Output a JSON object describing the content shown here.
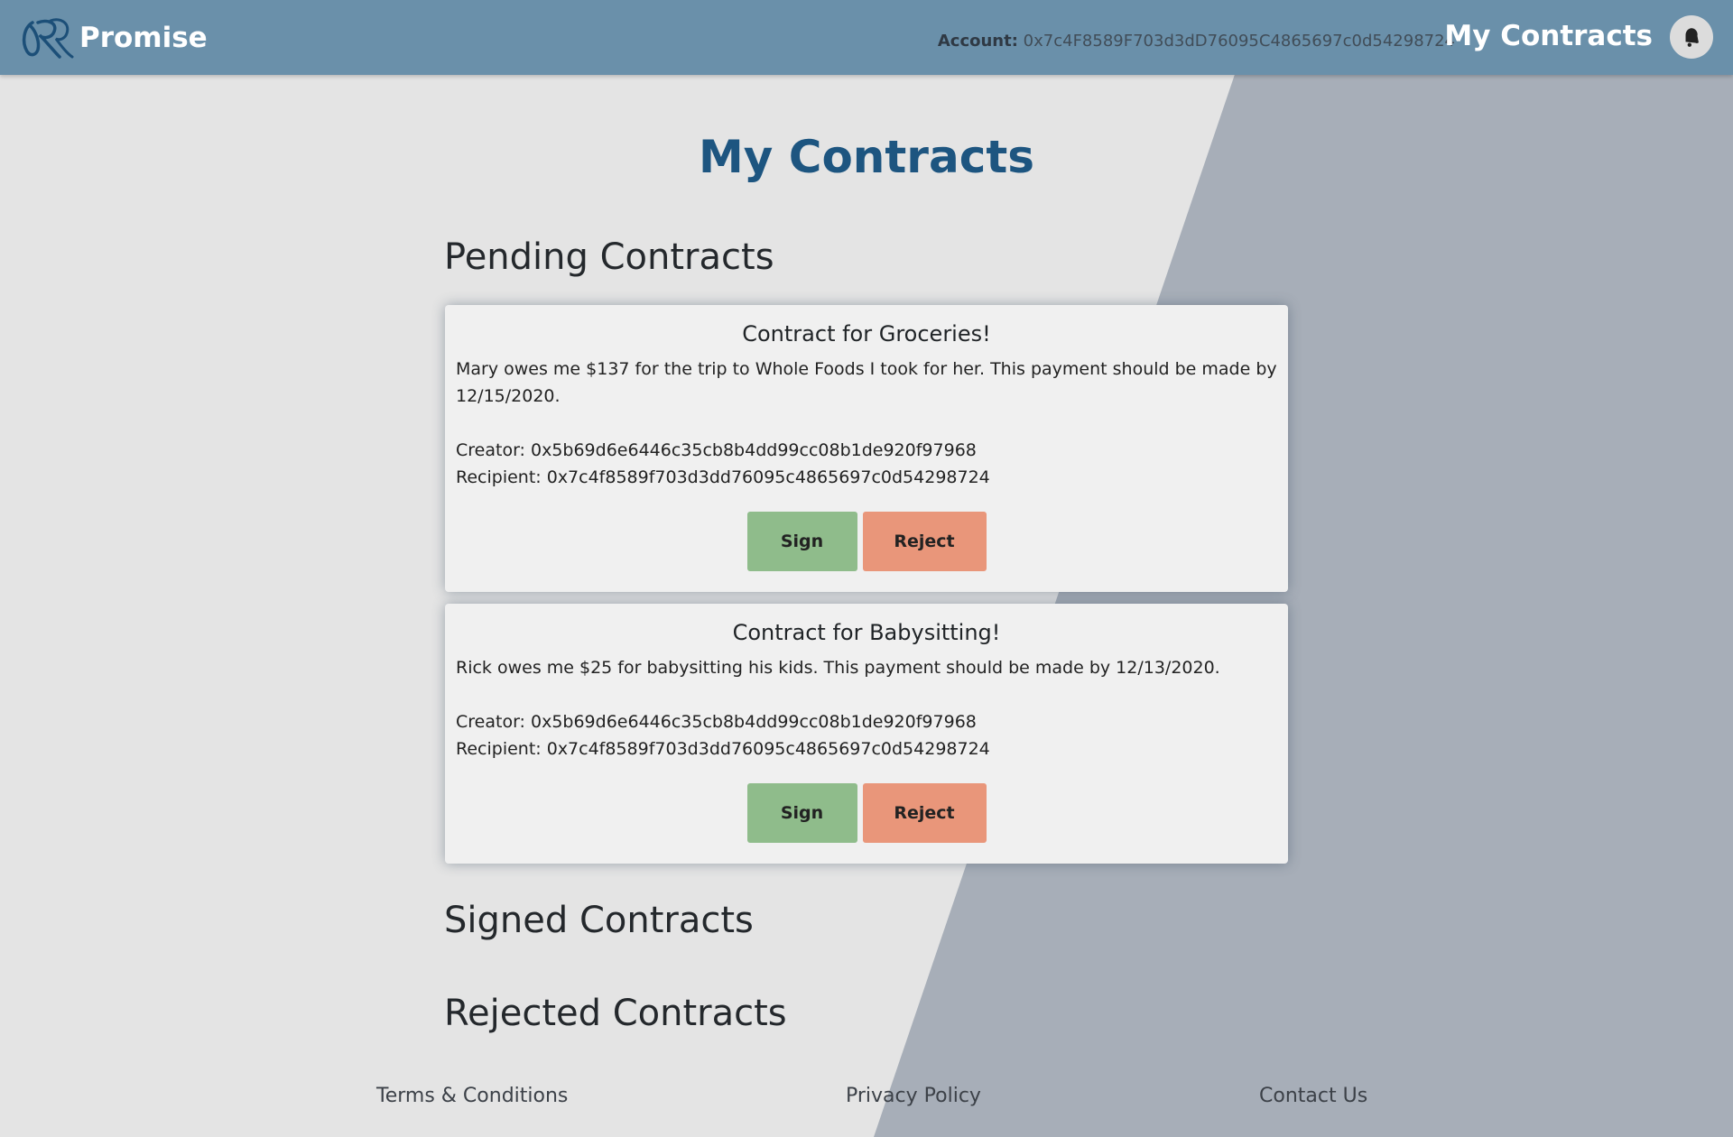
{
  "navbar": {
    "brand_name": "Promise",
    "account_label": "Account:",
    "account_value": "0x7c4F8589F703d3dD76095C4865697c0d54298724",
    "nav_title": "My Contracts"
  },
  "page_title": "My Contracts",
  "sections": {
    "pending": "Pending Contracts",
    "signed": "Signed Contracts",
    "rejected": "Rejected Contracts"
  },
  "pending_contracts": [
    {
      "title": "Contract for Groceries!",
      "description": "Mary owes me $137 for the trip to Whole Foods I took for her. This payment should be made by 12/15/2020.",
      "creator": "Creator: 0x5b69d6e6446c35cb8b4dd99cc08b1de920f97968",
      "recipient": "Recipient: 0x7c4f8589f703d3dd76095c4865697c0d54298724",
      "sign_label": "Sign",
      "reject_label": "Reject"
    },
    {
      "title": "Contract for Babysitting!",
      "description": "Rick owes me $25 for babysitting his kids. This payment should be made by 12/13/2020.",
      "creator": "Creator: 0x5b69d6e6446c35cb8b4dd99cc08b1de920f97968",
      "recipient": "Recipient: 0x7c4f8589f703d3dd76095c4865697c0d54298724",
      "sign_label": "Sign",
      "reject_label": "Reject"
    }
  ],
  "footer": {
    "terms": "Terms & Conditions",
    "privacy": "Privacy Policy",
    "contact": "Contact Us"
  },
  "icons": {
    "logo": "promise-logo-icon",
    "avatar": "bell-avatar-icon"
  },
  "colors": {
    "navbar": "#6a90aa",
    "title": "#1d5580",
    "sign": "#8fbc8b",
    "reject": "#e9967a",
    "background": "#e4e4e4",
    "background_accent": "#a7aeb8"
  }
}
